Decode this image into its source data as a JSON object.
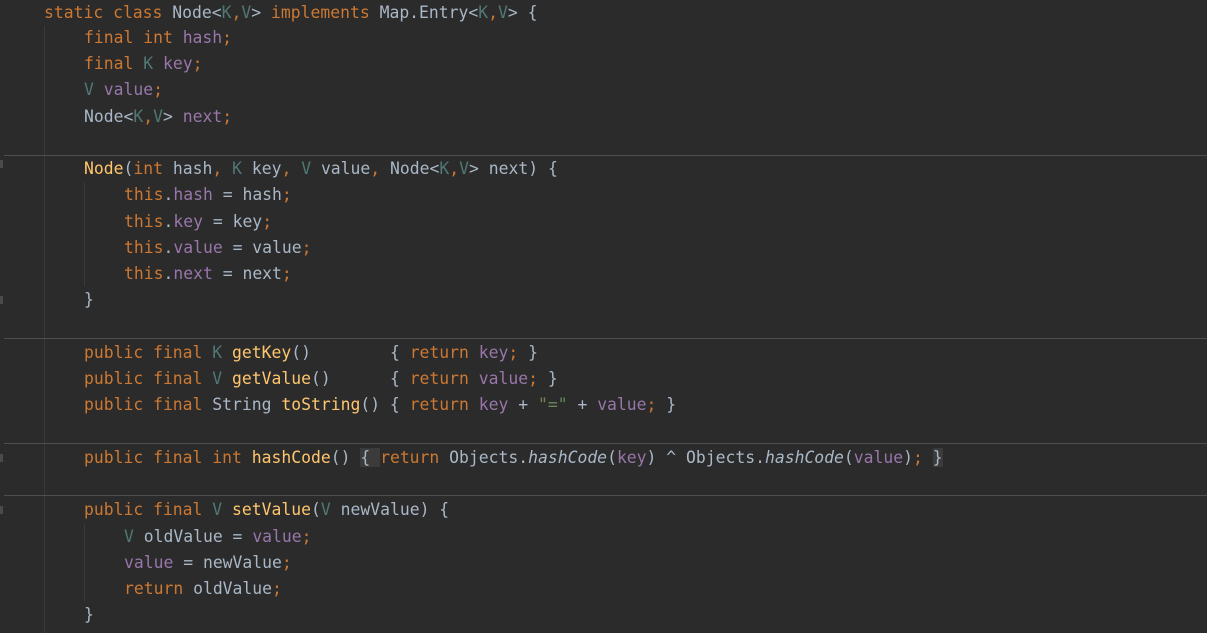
{
  "editor": {
    "theme": "darcula",
    "colors": {
      "background": "#2b2b2b",
      "keyword": "#cc7832",
      "type_param": "#507874",
      "field": "#9876aa",
      "method": "#ffc66d",
      "string": "#6a8759",
      "text": "#a9b7c6"
    },
    "lines": [
      {
        "tokens": [
          {
            "t": "static class ",
            "c": "kw"
          },
          {
            "t": "Node<",
            "c": "txt"
          },
          {
            "t": "K",
            "c": "tp"
          },
          {
            "t": ",",
            "c": "kw"
          },
          {
            "t": "V",
            "c": "tp"
          },
          {
            "t": "> ",
            "c": "txt"
          },
          {
            "t": "implements ",
            "c": "kw"
          },
          {
            "t": "Map.Entry<",
            "c": "txt"
          },
          {
            "t": "K",
            "c": "tp"
          },
          {
            "t": ",",
            "c": "kw"
          },
          {
            "t": "V",
            "c": "tp"
          },
          {
            "t": "> {",
            "c": "txt"
          }
        ]
      },
      {
        "tokens": [
          {
            "t": "final int ",
            "c": "kw"
          },
          {
            "t": "hash",
            "c": "fld"
          },
          {
            "t": ";",
            "c": "kw"
          }
        ]
      },
      {
        "tokens": [
          {
            "t": "final ",
            "c": "kw"
          },
          {
            "t": "K ",
            "c": "tp"
          },
          {
            "t": "key",
            "c": "fld"
          },
          {
            "t": ";",
            "c": "kw"
          }
        ]
      },
      {
        "tokens": [
          {
            "t": "V ",
            "c": "tp"
          },
          {
            "t": "value",
            "c": "fld"
          },
          {
            "t": ";",
            "c": "kw"
          }
        ]
      },
      {
        "tokens": [
          {
            "t": "Node<",
            "c": "txt"
          },
          {
            "t": "K",
            "c": "tp"
          },
          {
            "t": ",",
            "c": "kw"
          },
          {
            "t": "V",
            "c": "tp"
          },
          {
            "t": "> ",
            "c": "txt"
          },
          {
            "t": "next",
            "c": "fld"
          },
          {
            "t": ";",
            "c": "kw"
          }
        ]
      },
      {
        "tokens": [
          {
            "t": "Node",
            "c": "fn"
          },
          {
            "t": "(",
            "c": "txt"
          },
          {
            "t": "int ",
            "c": "kw"
          },
          {
            "t": "hash",
            "c": "txt"
          },
          {
            "t": ", ",
            "c": "kw"
          },
          {
            "t": "K ",
            "c": "tp"
          },
          {
            "t": "key",
            "c": "txt"
          },
          {
            "t": ", ",
            "c": "kw"
          },
          {
            "t": "V ",
            "c": "tp"
          },
          {
            "t": "value",
            "c": "txt"
          },
          {
            "t": ", ",
            "c": "kw"
          },
          {
            "t": "Node<",
            "c": "txt"
          },
          {
            "t": "K",
            "c": "tp"
          },
          {
            "t": ",",
            "c": "kw"
          },
          {
            "t": "V",
            "c": "tp"
          },
          {
            "t": "> next) {",
            "c": "txt"
          }
        ]
      },
      {
        "tokens": [
          {
            "t": "this",
            "c": "kw"
          },
          {
            "t": ".",
            "c": "txt"
          },
          {
            "t": "hash",
            "c": "fld"
          },
          {
            "t": " = hash",
            "c": "txt"
          },
          {
            "t": ";",
            "c": "kw"
          }
        ]
      },
      {
        "tokens": [
          {
            "t": "this",
            "c": "kw"
          },
          {
            "t": ".",
            "c": "txt"
          },
          {
            "t": "key",
            "c": "fld"
          },
          {
            "t": " = key",
            "c": "txt"
          },
          {
            "t": ";",
            "c": "kw"
          }
        ]
      },
      {
        "tokens": [
          {
            "t": "this",
            "c": "kw"
          },
          {
            "t": ".",
            "c": "txt"
          },
          {
            "t": "value",
            "c": "fld"
          },
          {
            "t": " = value",
            "c": "txt"
          },
          {
            "t": ";",
            "c": "kw"
          }
        ]
      },
      {
        "tokens": [
          {
            "t": "this",
            "c": "kw"
          },
          {
            "t": ".",
            "c": "txt"
          },
          {
            "t": "next",
            "c": "fld"
          },
          {
            "t": " = next",
            "c": "txt"
          },
          {
            "t": ";",
            "c": "kw"
          }
        ]
      },
      {
        "tokens": [
          {
            "t": "}",
            "c": "txt"
          }
        ]
      },
      {
        "tokens": [
          {
            "t": "public final ",
            "c": "kw"
          },
          {
            "t": "K ",
            "c": "tp"
          },
          {
            "t": "getKey",
            "c": "fn"
          },
          {
            "t": "()        { ",
            "c": "txt"
          },
          {
            "t": "return ",
            "c": "kw"
          },
          {
            "t": "key",
            "c": "fld"
          },
          {
            "t": "; ",
            "c": "kw"
          },
          {
            "t": "}",
            "c": "txt"
          }
        ]
      },
      {
        "tokens": [
          {
            "t": "public final ",
            "c": "kw"
          },
          {
            "t": "V ",
            "c": "tp"
          },
          {
            "t": "getValue",
            "c": "fn"
          },
          {
            "t": "()      { ",
            "c": "txt"
          },
          {
            "t": "return ",
            "c": "kw"
          },
          {
            "t": "value",
            "c": "fld"
          },
          {
            "t": "; ",
            "c": "kw"
          },
          {
            "t": "}",
            "c": "txt"
          }
        ]
      },
      {
        "tokens": [
          {
            "t": "public final ",
            "c": "kw"
          },
          {
            "t": "String ",
            "c": "txt"
          },
          {
            "t": "toString",
            "c": "fn"
          },
          {
            "t": "() { ",
            "c": "txt"
          },
          {
            "t": "return ",
            "c": "kw"
          },
          {
            "t": "key",
            "c": "fld"
          },
          {
            "t": " + ",
            "c": "txt"
          },
          {
            "t": "\"=\"",
            "c": "str"
          },
          {
            "t": " + ",
            "c": "txt"
          },
          {
            "t": "value",
            "c": "fld"
          },
          {
            "t": "; ",
            "c": "kw"
          },
          {
            "t": "}",
            "c": "txt"
          }
        ]
      },
      {
        "tokens": [
          {
            "t": "public final int ",
            "c": "kw"
          },
          {
            "t": "hashCode",
            "c": "fn"
          },
          {
            "t": "() ",
            "c": "txt"
          },
          {
            "t": "{ ",
            "c": "txt",
            "hl": true
          },
          {
            "t": "return ",
            "c": "kw"
          },
          {
            "t": "Objects.",
            "c": "txt"
          },
          {
            "t": "hashCode",
            "c": "txt",
            "i": true
          },
          {
            "t": "(",
            "c": "txt"
          },
          {
            "t": "key",
            "c": "fld"
          },
          {
            "t": ") ^ Objects.",
            "c": "txt"
          },
          {
            "t": "hashCode",
            "c": "txt",
            "i": true
          },
          {
            "t": "(",
            "c": "txt"
          },
          {
            "t": "value",
            "c": "fld"
          },
          {
            "t": ")",
            "c": "txt"
          },
          {
            "t": ";",
            "c": "kw"
          },
          {
            "t": " ",
            "c": "txt"
          },
          {
            "t": "}",
            "c": "txt",
            "hl": true
          }
        ]
      },
      {
        "tokens": [
          {
            "t": "public final ",
            "c": "kw"
          },
          {
            "t": "V ",
            "c": "tp"
          },
          {
            "t": "setValue",
            "c": "fn"
          },
          {
            "t": "(",
            "c": "txt"
          },
          {
            "t": "V ",
            "c": "tp"
          },
          {
            "t": "newValue) {",
            "c": "txt"
          }
        ]
      },
      {
        "tokens": [
          {
            "t": "V ",
            "c": "tp"
          },
          {
            "t": "oldValue = ",
            "c": "txt"
          },
          {
            "t": "value",
            "c": "fld"
          },
          {
            "t": ";",
            "c": "kw"
          }
        ]
      },
      {
        "tokens": [
          {
            "t": "value",
            "c": "fld"
          },
          {
            "t": " = newValue",
            "c": "txt"
          },
          {
            "t": ";",
            "c": "kw"
          }
        ]
      },
      {
        "tokens": [
          {
            "t": "return ",
            "c": "kw"
          },
          {
            "t": "oldValue",
            "c": "txt"
          },
          {
            "t": ";",
            "c": "kw"
          }
        ]
      },
      {
        "tokens": [
          {
            "t": "}",
            "c": "txt"
          }
        ]
      }
    ]
  }
}
